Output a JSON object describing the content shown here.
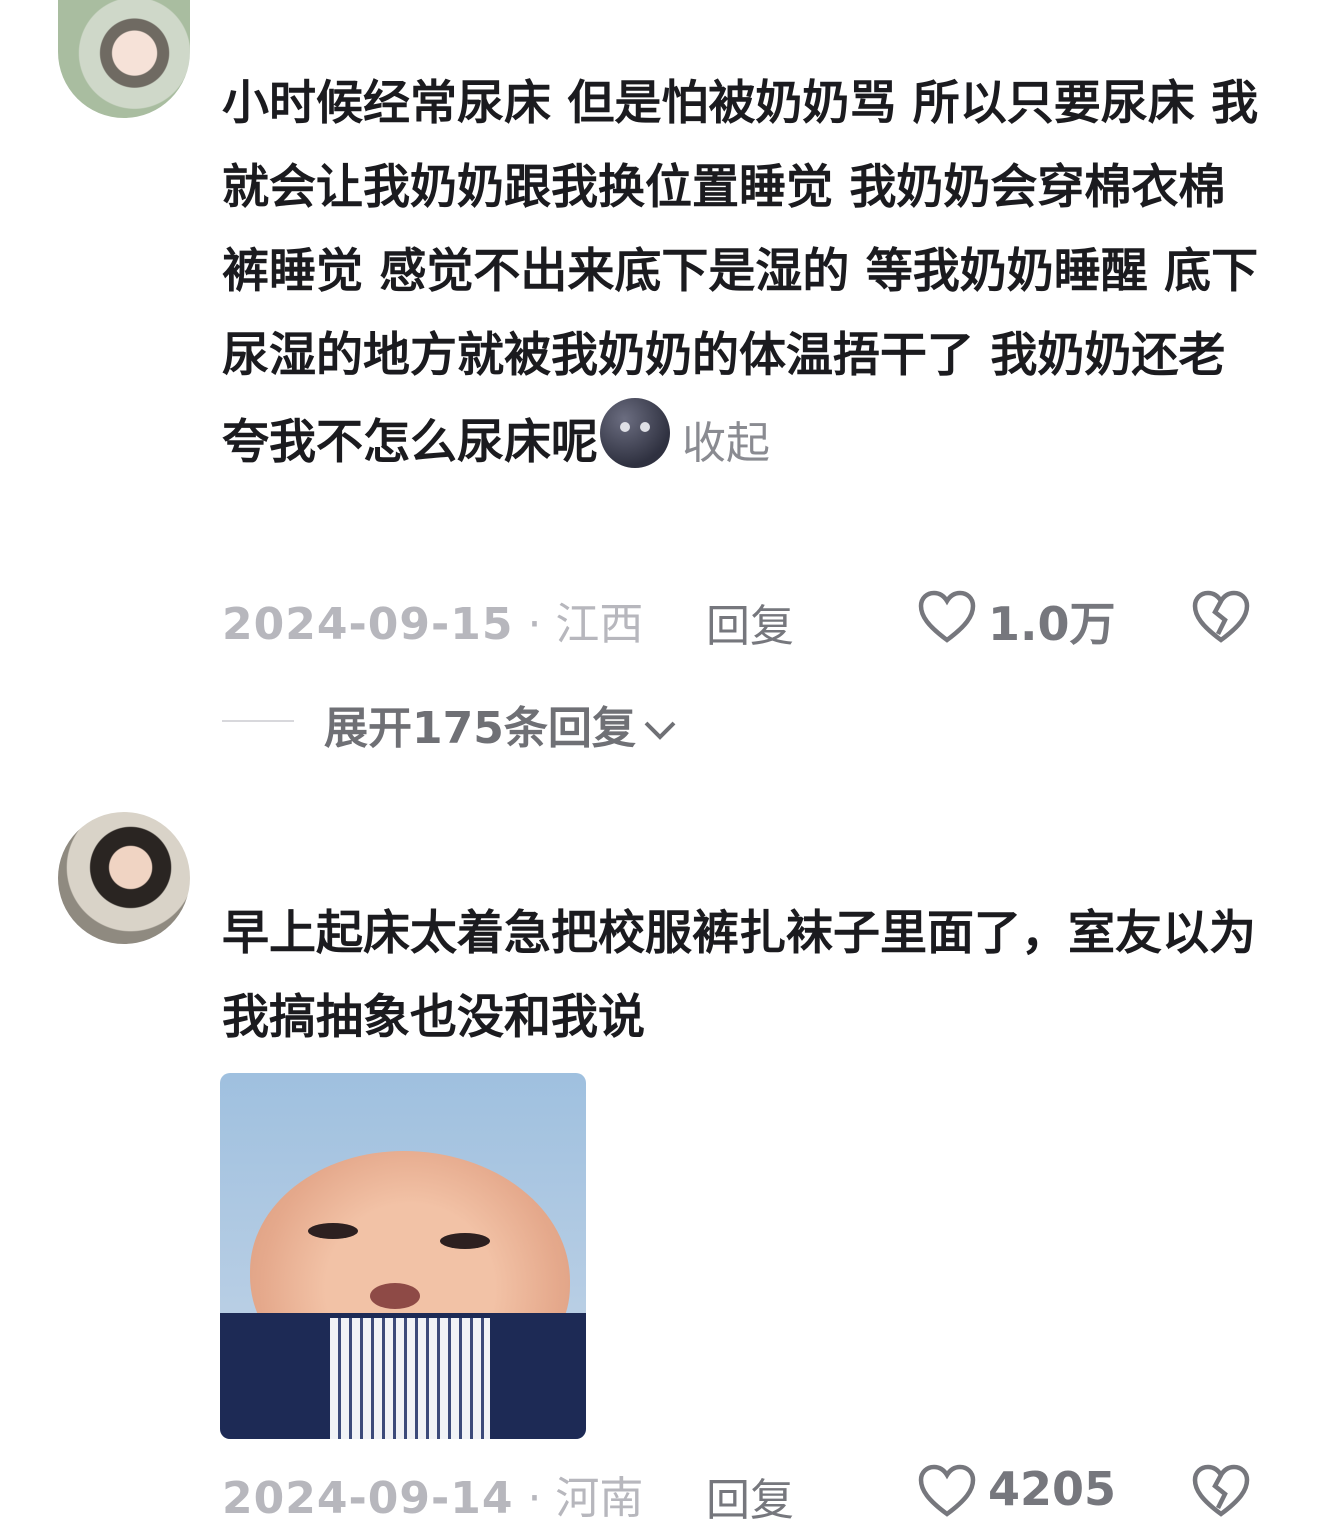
{
  "comments": [
    {
      "username": "",
      "text": "小时候经常尿床 但是怕被奶奶骂 所以只要尿床 我就会让我奶奶跟我换位置睡觉 我奶奶会穿棉衣棉裤睡觉 感觉不出来底下是湿的 等我奶奶睡醒 底下尿湿的地方就被我奶奶的体温捂干了 我奶奶还老夸我不怎么尿床呢",
      "collapse_label": "收起",
      "date": "2024-09-15",
      "separator": " · ",
      "location": "江西",
      "reply_label": "回复",
      "likes": "1.0万",
      "expand_label": "展开175条回复"
    },
    {
      "username": "",
      "text": "早上起床太着急把校服裤扎袜子里面了，室友以为我搞抽象也没和我说",
      "date": "2024-09-14",
      "separator": " · ",
      "location": "河南",
      "reply_label": "回复",
      "likes": "4205"
    }
  ],
  "icons": {
    "like": "heart-outline-icon",
    "dislike": "broken-heart-icon",
    "emoji": "new-moon-face-emoji",
    "expand": "chevron-down-icon"
  },
  "colors": {
    "text": "#1b1b1f",
    "meta": "#b7b7bd",
    "action": "#76777d"
  }
}
